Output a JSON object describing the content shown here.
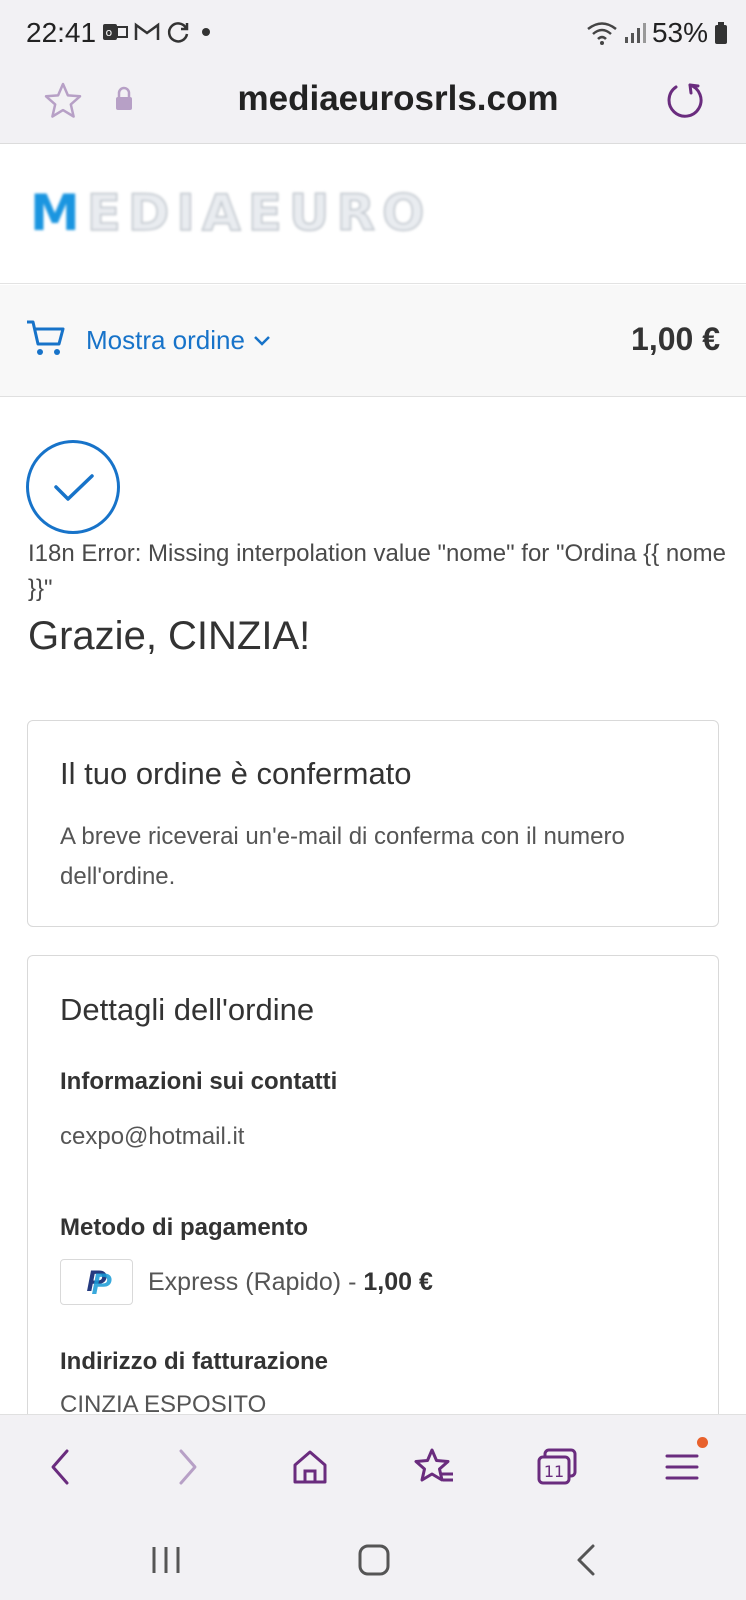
{
  "status_bar": {
    "time": "22:41",
    "battery": "53%",
    "icons": [
      "outlook-icon",
      "gmail-icon",
      "sync-icon",
      "dot-icon",
      "wifi-icon",
      "signal-icon",
      "battery-icon"
    ]
  },
  "browser": {
    "url": "mediaeurosrls.com"
  },
  "logo": {
    "first_letter": "M",
    "rest": "EDIAEURO"
  },
  "order_summary": {
    "toggle_label": "Mostra ordine",
    "total": "1,00 €"
  },
  "confirmation": {
    "error_line": "I18n Error: Missing interpolation value \"nome\" for \"Ordina {{ nome }}\"",
    "thanks": "Grazie, CINZIA!",
    "card_title": "Il tuo ordine è confermato",
    "card_text": "A breve riceverai un'e-mail di conferma con il numero dell'ordine."
  },
  "details": {
    "title": "Dettagli dell'ordine",
    "contact_heading": "Informazioni sui contatti",
    "contact_email": "cexpo@hotmail.it",
    "payment_heading": "Metodo di pagamento",
    "payment_method": "Express (Rapido)",
    "payment_separator": " - ",
    "payment_amount": "1,00 €",
    "billing_heading": "Indirizzo di fatturazione",
    "billing_name": "CINZIA ESPOSITO"
  },
  "browser_nav": {
    "tab_count": "11"
  },
  "colors": {
    "accent": "#1773c9",
    "browser_purple": "#6a2c7e",
    "notification": "#e8612c"
  }
}
